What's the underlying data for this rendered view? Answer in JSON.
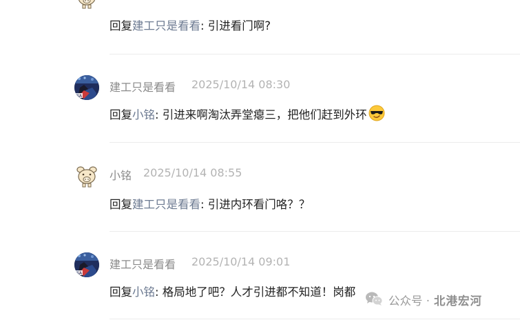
{
  "comments": [
    {
      "username": "",
      "timestamp": "",
      "reply_prefix": "回复",
      "reply_target": "建工只是看看",
      "reply_text": ": 引进看门啊?",
      "avatar": "pig-avatar"
    },
    {
      "username": "建工只是看看",
      "timestamp": "2025/10/14 08:30",
      "reply_prefix": "回复",
      "reply_target": "小铭",
      "reply_text": ": 引进来啊淘汰弄堂瘪三，把他们赶到外环",
      "emoji": "sunglasses-emoji",
      "avatar": "fan-avatar"
    },
    {
      "username": "小铭",
      "timestamp": "2025/10/14 08:55",
      "reply_prefix": "回复",
      "reply_target": "建工只是看看",
      "reply_text": ": 引进内环看门咯？？",
      "avatar": "pig-avatar"
    },
    {
      "username": "建工只是看看",
      "timestamp": "2025/10/14 09:01",
      "reply_prefix": "回复",
      "reply_target": "小铭",
      "reply_text": ": 格局地了吧？人才引进都不知道！岗都",
      "avatar": "fan-avatar"
    }
  ],
  "watermark": {
    "label": "公众号 ·",
    "name": "北港宏河",
    "icon": "wechat-icon"
  },
  "colors": {
    "username": "#8a8a8a",
    "timestamp": "#b3b3b3",
    "reply_text": "#222222",
    "reply_target": "#6c7a91",
    "divider": "#ececec"
  }
}
